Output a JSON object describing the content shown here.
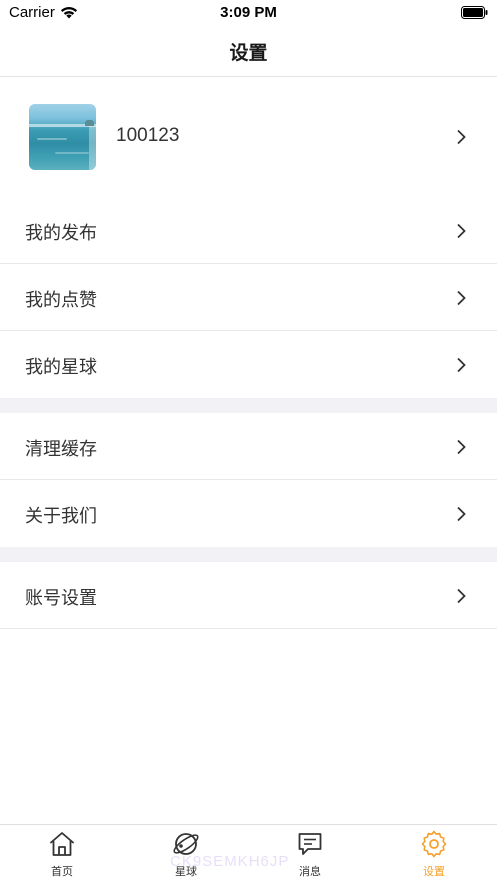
{
  "status_bar": {
    "carrier": "Carrier",
    "time": "3:09 PM"
  },
  "nav": {
    "title": "设置"
  },
  "profile": {
    "user_id": "100123",
    "avatar": "ocean-avatar"
  },
  "menu": {
    "group1": [
      {
        "label": "我的发布"
      },
      {
        "label": "我的点赞"
      },
      {
        "label": "我的星球"
      }
    ],
    "group2": [
      {
        "label": "清理缓存"
      },
      {
        "label": "关于我们"
      }
    ],
    "group3": [
      {
        "label": "账号设置"
      }
    ]
  },
  "tab_bar": {
    "tabs": [
      {
        "label": "首页",
        "icon": "home-icon"
      },
      {
        "label": "星球",
        "icon": "planet-icon"
      },
      {
        "label": "消息",
        "icon": "message-icon"
      },
      {
        "label": "设置",
        "icon": "settings-icon"
      }
    ],
    "active_index": 3,
    "active_color": "#f5a02a",
    "watermark": "CK9SEMKH6JP"
  }
}
